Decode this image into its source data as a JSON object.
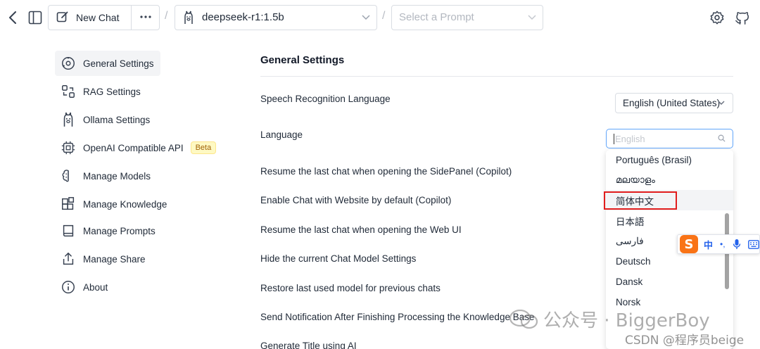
{
  "header": {
    "new_chat_label": "New Chat",
    "model_label": "deepseek-r1:1.5b",
    "prompt_placeholder": "Select a Prompt",
    "separator": "/"
  },
  "sidebar": {
    "items": [
      {
        "label": "General Settings",
        "icon": "gear-icon",
        "active": true
      },
      {
        "label": "RAG Settings",
        "icon": "rag-icon"
      },
      {
        "label": "Ollama Settings",
        "icon": "llama-icon"
      },
      {
        "label": "OpenAI Compatible API",
        "icon": "chip-icon",
        "badge": "Beta"
      },
      {
        "label": "Manage Models",
        "icon": "brain-icon"
      },
      {
        "label": "Manage Knowledge",
        "icon": "blocks-icon"
      },
      {
        "label": "Manage Prompts",
        "icon": "book-icon"
      },
      {
        "label": "Manage Share",
        "icon": "share-icon"
      },
      {
        "label": "About",
        "icon": "info-icon"
      }
    ]
  },
  "main": {
    "title": "General Settings",
    "settings": [
      {
        "label": "Speech Recognition Language",
        "value": "English (United States)"
      },
      {
        "label": "Language"
      },
      {
        "label": "Resume the last chat when opening the SidePanel (Copilot)"
      },
      {
        "label": "Enable Chat with Website by default (Copilot)"
      },
      {
        "label": "Resume the last chat when opening the Web UI"
      },
      {
        "label": "Hide the current Chat Model Settings"
      },
      {
        "label": "Restore last used model for previous chats"
      },
      {
        "label": "Send Notification After Finishing Processing the Knowledge Base"
      },
      {
        "label": "Generate Title using AI"
      }
    ],
    "language_search": {
      "placeholder": "English"
    },
    "language_options": [
      "Português (Brasil)",
      "മലയാളം",
      "简体中文",
      "日本語",
      "فارسی",
      "Deutsch",
      "Dansk",
      "Norsk"
    ],
    "highlighted_option": "简体中文"
  },
  "ime": {
    "logo": "S",
    "mode": "中",
    "punct": "•,"
  },
  "watermark": {
    "main": "公众号 · BiggerBoy",
    "sub": "CSDN @程序员beige"
  },
  "colors": {
    "accent_focus": "#60a5fa",
    "highlight_border": "#e11d1d",
    "beta_bg": "#fef9c3",
    "ime_logo": "#f97316"
  }
}
